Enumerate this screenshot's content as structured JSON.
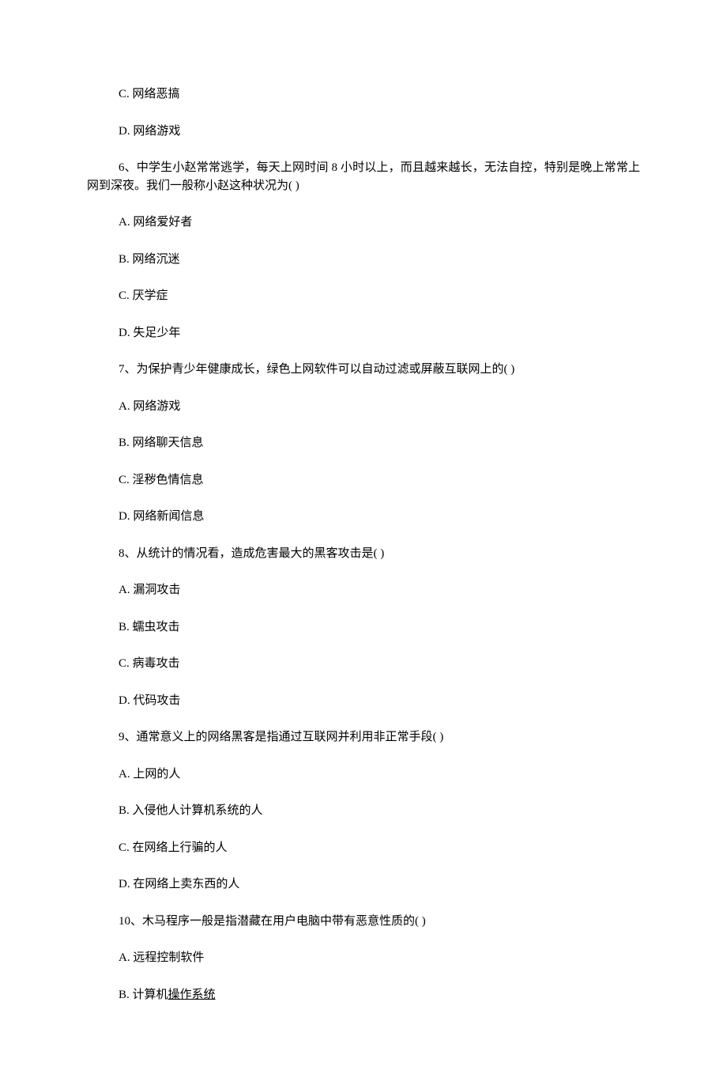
{
  "lines": {
    "q5_c": "C. 网络恶搞",
    "q5_d": "D. 网络游戏",
    "q6_text": "6、中学生小赵常常逃学，每天上网时间 8 小时以上，而且越来越长，无法自控，特别是晚上常常上网到深夜。我们一般称小赵这种状况为( )",
    "q6_a": "A. 网络爱好者",
    "q6_b": "B. 网络沉迷",
    "q6_c": "C. 厌学症",
    "q6_d": "D. 失足少年",
    "q7_text": "7、为保护青少年健康成长，绿色上网软件可以自动过滤或屏蔽互联网上的( )",
    "q7_a": "A. 网络游戏",
    "q7_b": "B. 网络聊天信息",
    "q7_c": "C. 淫秽色情信息",
    "q7_d": "D. 网络新闻信息",
    "q8_text": "8、从统计的情况看，造成危害最大的黑客攻击是( )",
    "q8_a": "A. 漏洞攻击",
    "q8_b": "B. 蠕虫攻击",
    "q8_c": "C. 病毒攻击",
    "q8_d": "D. 代码攻击",
    "q9_text": "9、通常意义上的网络黑客是指通过互联网并利用非正常手段( )",
    "q9_a": "A. 上网的人",
    "q9_b": "B. 入侵他人计算机系统的人",
    "q9_c": "C. 在网络上行骗的人",
    "q9_d": "D. 在网络上卖东西的人",
    "q10_text": "10、木马程序一般是指潜藏在用户电脑中带有恶意性质的( )",
    "q10_a": "A. 远程控制软件",
    "q10_b_pre": "B. 计算机",
    "q10_b_u": "操作系统"
  }
}
